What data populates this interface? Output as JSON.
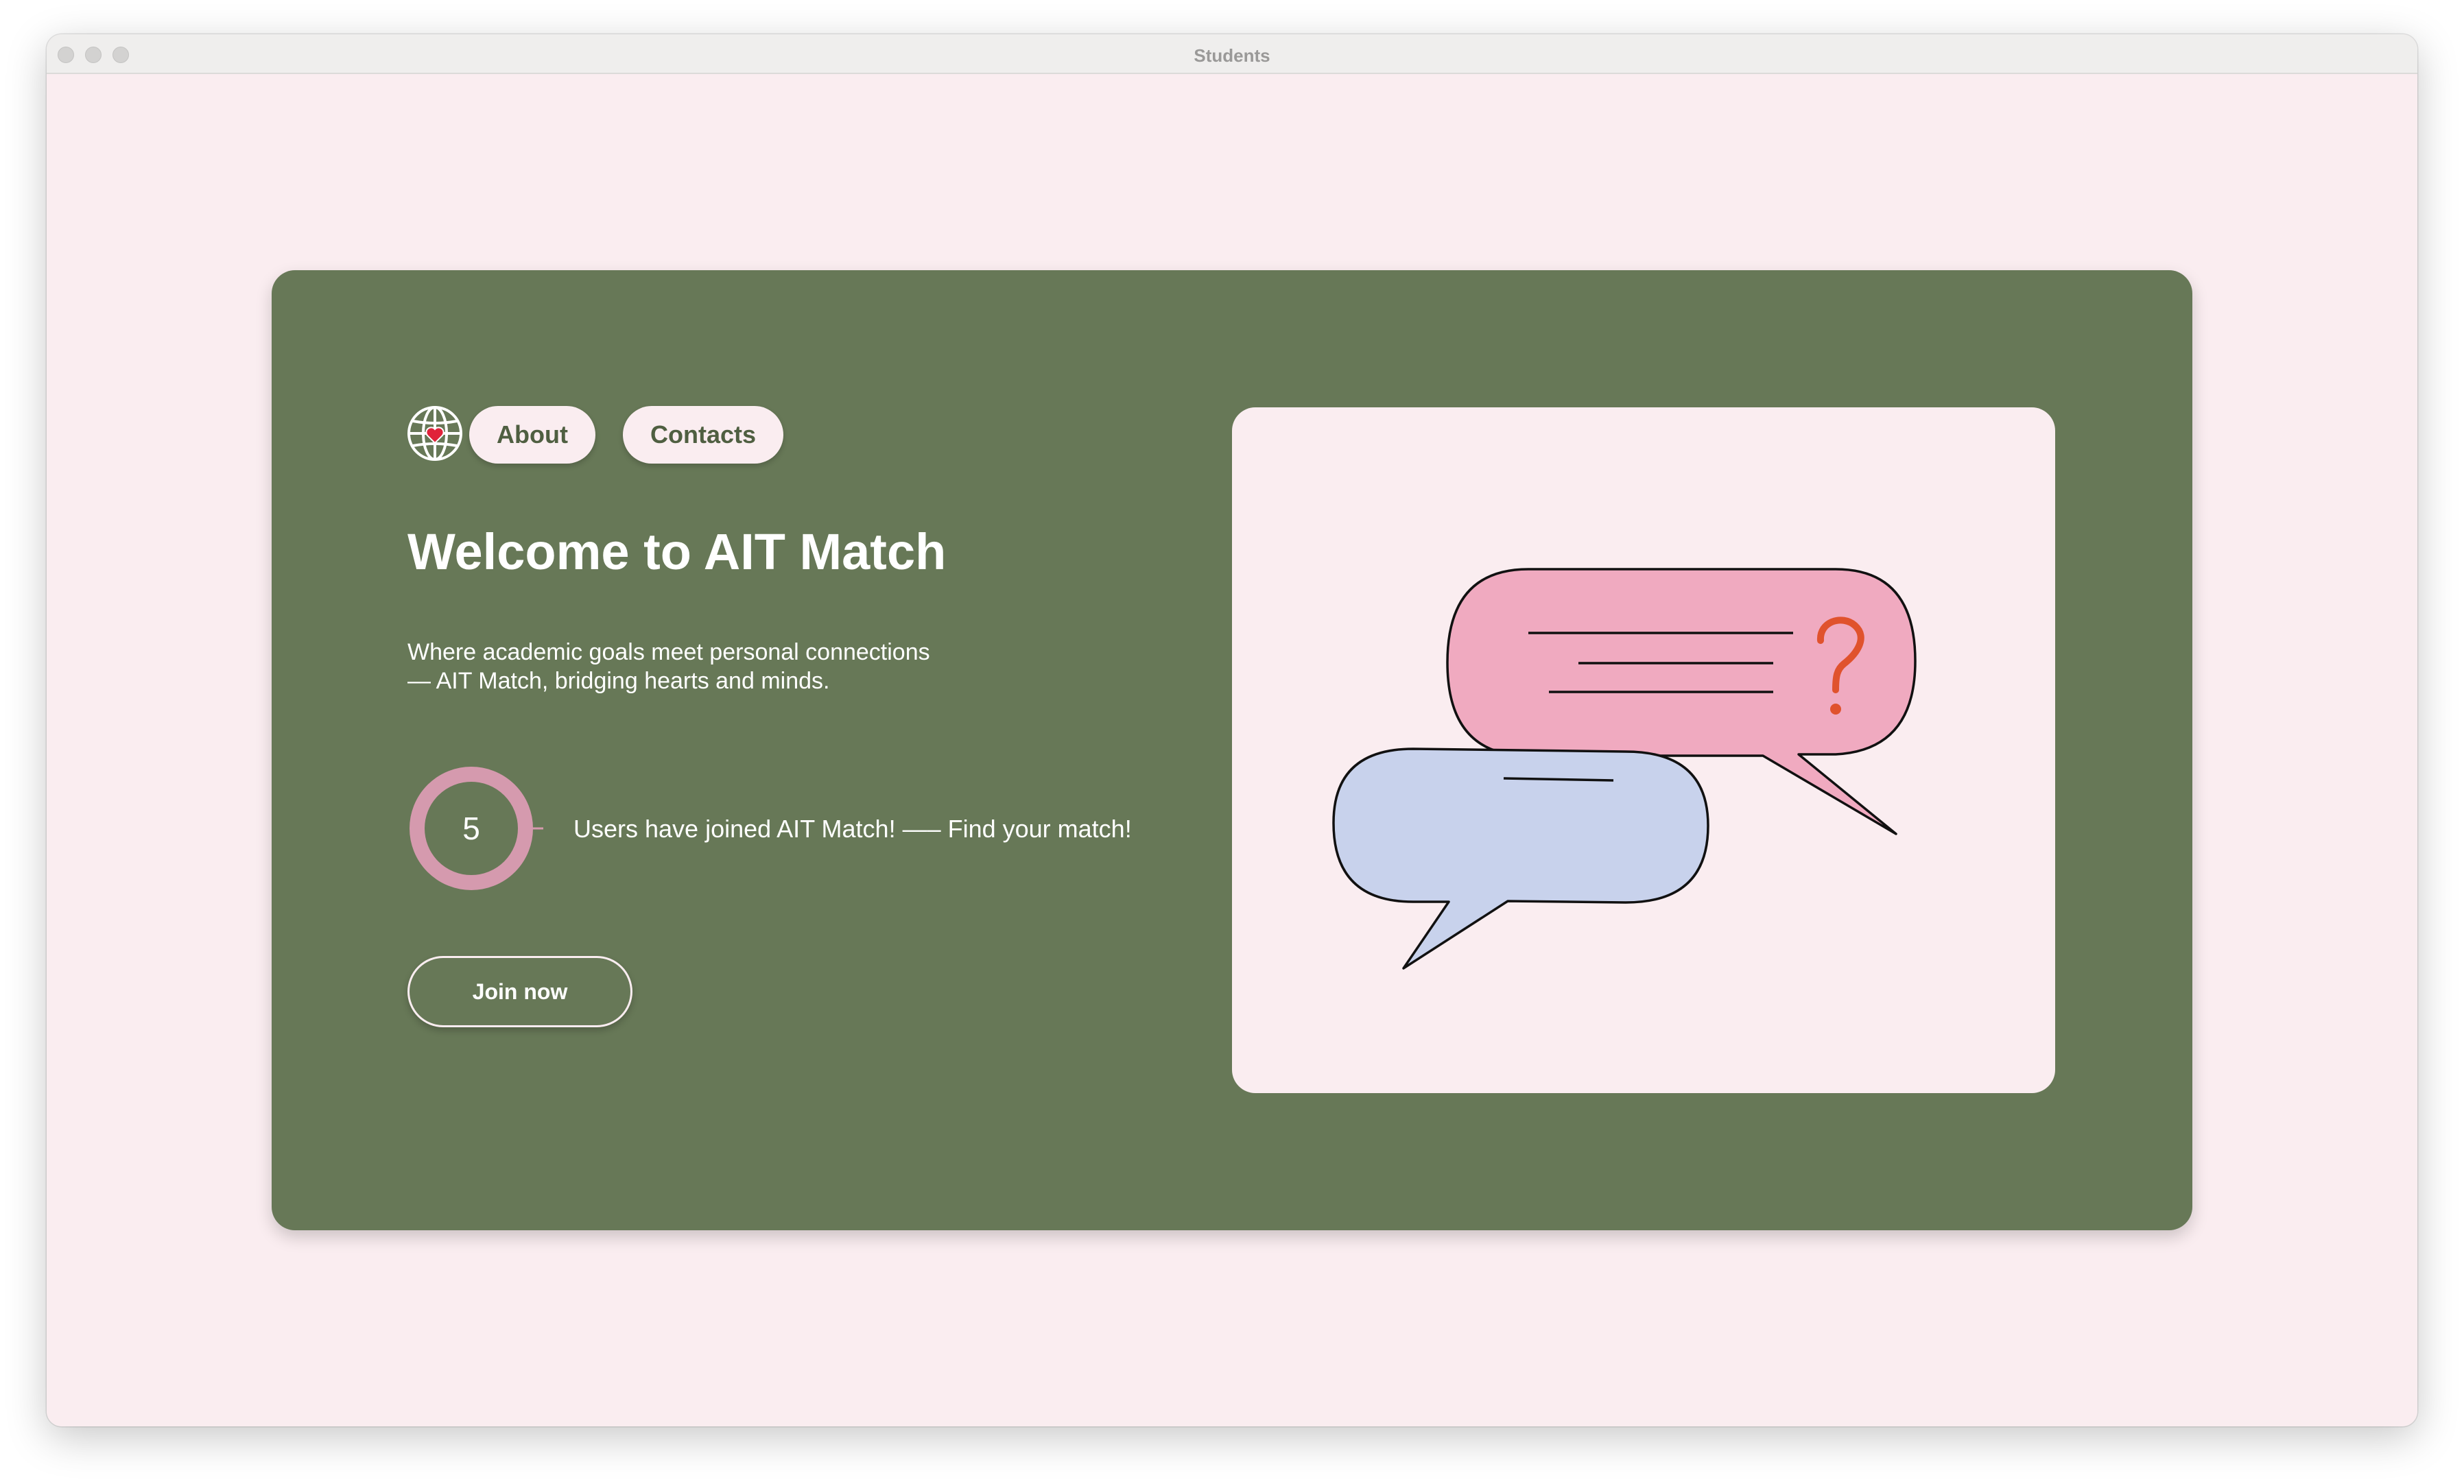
{
  "window": {
    "title": "Students"
  },
  "nav": {
    "logo_icon": "globe-heart-icon",
    "about_label": "About",
    "contacts_label": "Contacts"
  },
  "hero": {
    "title": "Welcome to AIT Match",
    "tagline_line1": "Where academic goals meet personal connections",
    "tagline_line2": "— AIT Match, bridging hearts and minds.",
    "user_count": "5",
    "counter_text": "Users have joined AIT Match! —– Find your match!",
    "join_label": "Join now"
  },
  "illustration": {
    "icon": "speech-bubbles-question-icon"
  },
  "colors": {
    "page_background": "#faedf0",
    "card_background": "#677857",
    "bubble_pink": "#f0aac0",
    "bubble_blue": "#c8d2ec",
    "ring_pink": "#d59aae",
    "question_mark": "#e0522d",
    "heart_red": "#e0223a"
  }
}
